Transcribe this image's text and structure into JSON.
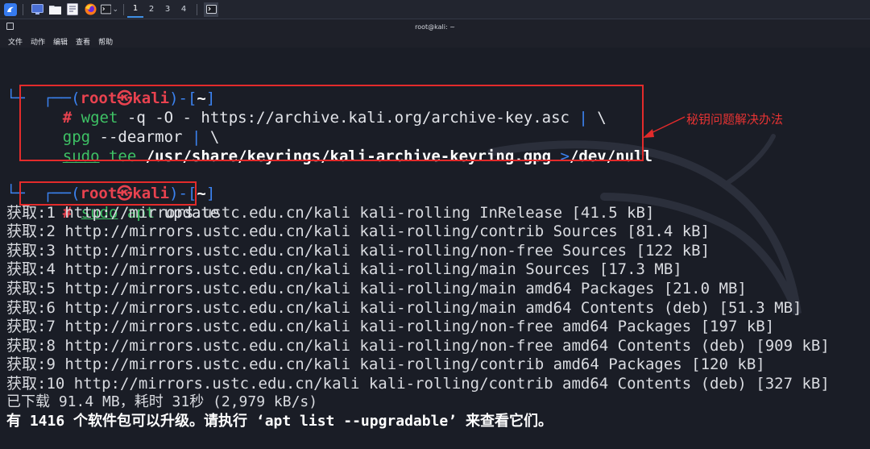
{
  "taskbar": {
    "workspaces": [
      "1",
      "2",
      "3",
      "4"
    ],
    "active_workspace": "1",
    "icons": [
      "kali-menu-icon",
      "desktop-icon",
      "files-icon",
      "text-editor-icon",
      "firefox-icon",
      "terminal-icon"
    ]
  },
  "window": {
    "title": "root@kali: ~"
  },
  "menubar": {
    "items": [
      "文件",
      "动作",
      "编辑",
      "查看",
      "帮助"
    ]
  },
  "terminal": {
    "prompt1": {
      "corner_top": "┌──(",
      "user": "root",
      "skull": "㉿",
      "host": "kali",
      "sep": ")-[",
      "dir": "~",
      "close": "]"
    },
    "cmd1": {
      "hash": "#",
      "line1_cmd": "wget",
      "line1_args": " -q -O - https://archive.kali.org/archive-key.asc ",
      "pipe": "|",
      "backslash": " \\",
      "line2_cmd": "gpg",
      "line2_args": " --dearmor ",
      "line3_sudo": "sudo",
      "line3_tee": " tee",
      "line3_path": " /usr/share/keyrings/kali-archive-keyring.gpg ",
      "line3_redirect": ">",
      "line3_null": "/dev/null"
    },
    "cmd2": {
      "hash": "#",
      "sudo": "sudo",
      "apt": " apt",
      "args": " update"
    },
    "output": [
      {
        "label": "获取",
        "text": ":1 http://mirrors.ustc.edu.cn/kali kali-rolling InRelease [41.5 kB]"
      },
      {
        "label": "获取",
        "text": ":2 http://mirrors.ustc.edu.cn/kali kali-rolling/contrib Sources [81.4 kB]"
      },
      {
        "label": "获取",
        "text": ":3 http://mirrors.ustc.edu.cn/kali kali-rolling/non-free Sources [122 kB]"
      },
      {
        "label": "获取",
        "text": ":4 http://mirrors.ustc.edu.cn/kali kali-rolling/main Sources [17.3 MB]"
      },
      {
        "label": "获取",
        "text": ":5 http://mirrors.ustc.edu.cn/kali kali-rolling/main amd64 Packages [21.0 MB]"
      },
      {
        "label": "获取",
        "text": ":6 http://mirrors.ustc.edu.cn/kali kali-rolling/main amd64 Contents (deb) [51.3 MB]"
      },
      {
        "label": "获取",
        "text": ":7 http://mirrors.ustc.edu.cn/kali kali-rolling/non-free amd64 Packages [197 kB]"
      },
      {
        "label": "获取",
        "text": ":8 http://mirrors.ustc.edu.cn/kali kali-rolling/non-free amd64 Contents (deb) [909 kB]"
      },
      {
        "label": "获取",
        "text": ":9 http://mirrors.ustc.edu.cn/kali kali-rolling/contrib amd64 Packages [120 kB]"
      },
      {
        "label": "获取",
        "text": ":10 http://mirrors.ustc.edu.cn/kali kali-rolling/contrib amd64 Contents (deb) [327 kB]"
      }
    ],
    "summary": "已下载 91.4 MB，耗时 31秒 (2,979 kB/s)",
    "upgrade_notice": "有 1416 个软件包可以升级。请执行 ‘apt list --upgradable’ 来查看它们。"
  },
  "annotation": {
    "text": "秘钥问题解决办法",
    "color": "#e53333"
  },
  "colors": {
    "prompt_frame": "#3b82f0",
    "prompt_user": "#e8424f",
    "command": "#3ec265",
    "highlight_box": "#e32b2b",
    "terminal_bg": "#1a1d26"
  }
}
